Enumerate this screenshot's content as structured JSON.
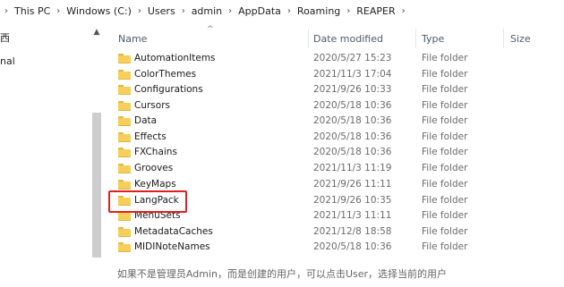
{
  "breadcrumb": [
    "This PC",
    "Windows (C:)",
    "Users",
    "admin",
    "AppData",
    "Roaming",
    "REAPER"
  ],
  "nav": {
    "item_1": "西",
    "item_2": "nal"
  },
  "columns": {
    "name": "Name",
    "date": "Date modified",
    "type": "Type",
    "size": "Size"
  },
  "rows": [
    {
      "name": "AutomationItems",
      "date": "2020/5/27 15:23",
      "type": "File folder"
    },
    {
      "name": "ColorThemes",
      "date": "2021/11/3 17:04",
      "type": "File folder"
    },
    {
      "name": "Configurations",
      "date": "2021/9/26 10:33",
      "type": "File folder"
    },
    {
      "name": "Cursors",
      "date": "2020/5/18 10:36",
      "type": "File folder"
    },
    {
      "name": "Data",
      "date": "2020/5/18 10:36",
      "type": "File folder"
    },
    {
      "name": "Effects",
      "date": "2020/5/18 10:36",
      "type": "File folder"
    },
    {
      "name": "FXChains",
      "date": "2020/5/18 10:36",
      "type": "File folder"
    },
    {
      "name": "Grooves",
      "date": "2021/11/3 11:19",
      "type": "File folder"
    },
    {
      "name": "KeyMaps",
      "date": "2021/9/26 11:11",
      "type": "File folder"
    },
    {
      "name": "LangPack",
      "date": "2021/9/26 10:35",
      "type": "File folder"
    },
    {
      "name": "MenuSets",
      "date": "2021/11/3 11:11",
      "type": "File folder"
    },
    {
      "name": "MetadataCaches",
      "date": "2021/12/8 18:58",
      "type": "File folder"
    },
    {
      "name": "MIDINoteNames",
      "date": "2020/5/18 10:36",
      "type": "File folder"
    }
  ],
  "caption": "如果不是管理员Admin，而是创建的用户，可以点击User，选择当前的用户",
  "colors": {
    "folder": "#f6cf5b",
    "highlight": "#e02020"
  }
}
